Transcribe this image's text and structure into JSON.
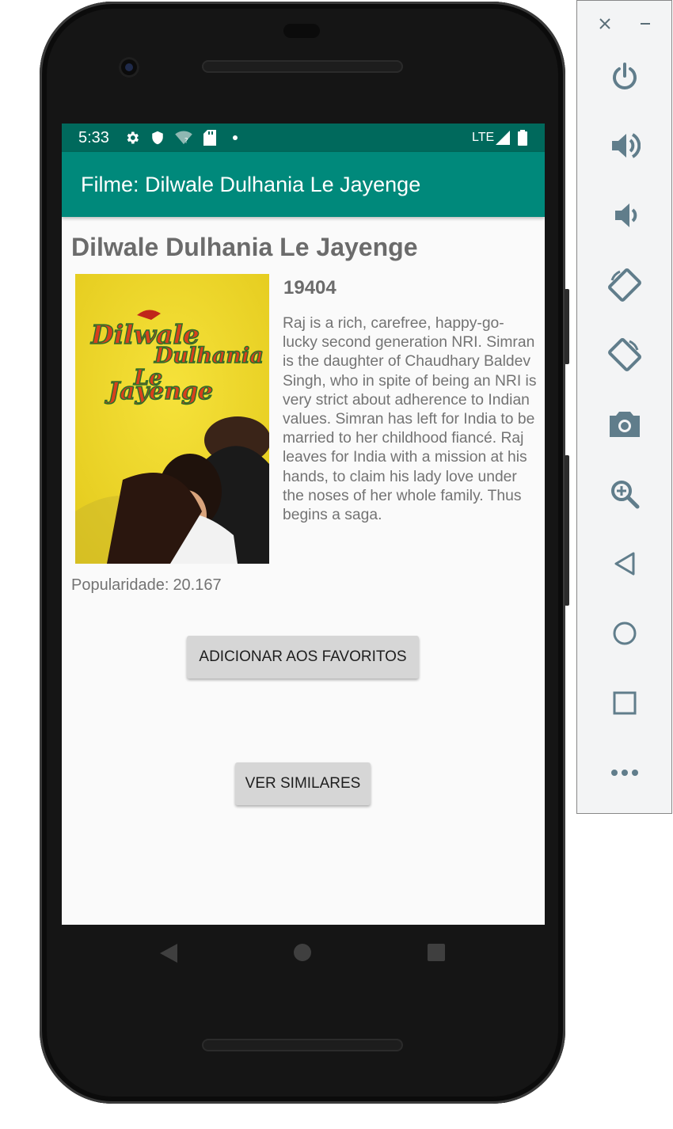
{
  "status_bar": {
    "time": "5:33",
    "network": "LTE"
  },
  "app_bar": {
    "title": "Filme: Dilwale Dulhania Le Jayenge"
  },
  "movie": {
    "title": "Dilwale Dulhania Le Jayenge",
    "id": "19404",
    "overview": "Raj is a rich, carefree, happy-go-lucky second generation NRI. Simran is the daughter of Chaudhary Baldev Singh, who in spite of being an NRI is very strict about adherence to Indian values. Simran has left for India to be married to her childhood fiancé. Raj leaves for India with a mission at his hands, to claim his lady love under the noses of her whole family. Thus begins a saga.",
    "popularity_label": "Popularidade:",
    "popularity_value": "20.167",
    "poster_title_lines": [
      "Dilwale",
      "Dulhania",
      "Le",
      "Jayenge"
    ]
  },
  "buttons": {
    "favorite": "ADICIONAR AOS FAVORITOS",
    "similar": "VER SIMILARES"
  },
  "colors": {
    "status_bar": "#00695c",
    "app_bar": "#00897b",
    "background": "#fafafa",
    "button": "#d6d6d6"
  },
  "icons": {
    "status": [
      "settings-icon",
      "shield-icon",
      "wifi-icon",
      "sd-card-icon",
      "dot-icon",
      "signal-icon",
      "battery-icon"
    ],
    "nav": [
      "back-icon",
      "home-icon",
      "recents-icon"
    ],
    "toolbar": [
      "close-icon",
      "minimize-icon",
      "power-icon",
      "volume-up-icon",
      "volume-down-icon",
      "rotate-left-icon",
      "rotate-right-icon",
      "camera-icon",
      "zoom-icon",
      "back-icon",
      "home-icon",
      "overview-icon",
      "more-icon"
    ]
  }
}
